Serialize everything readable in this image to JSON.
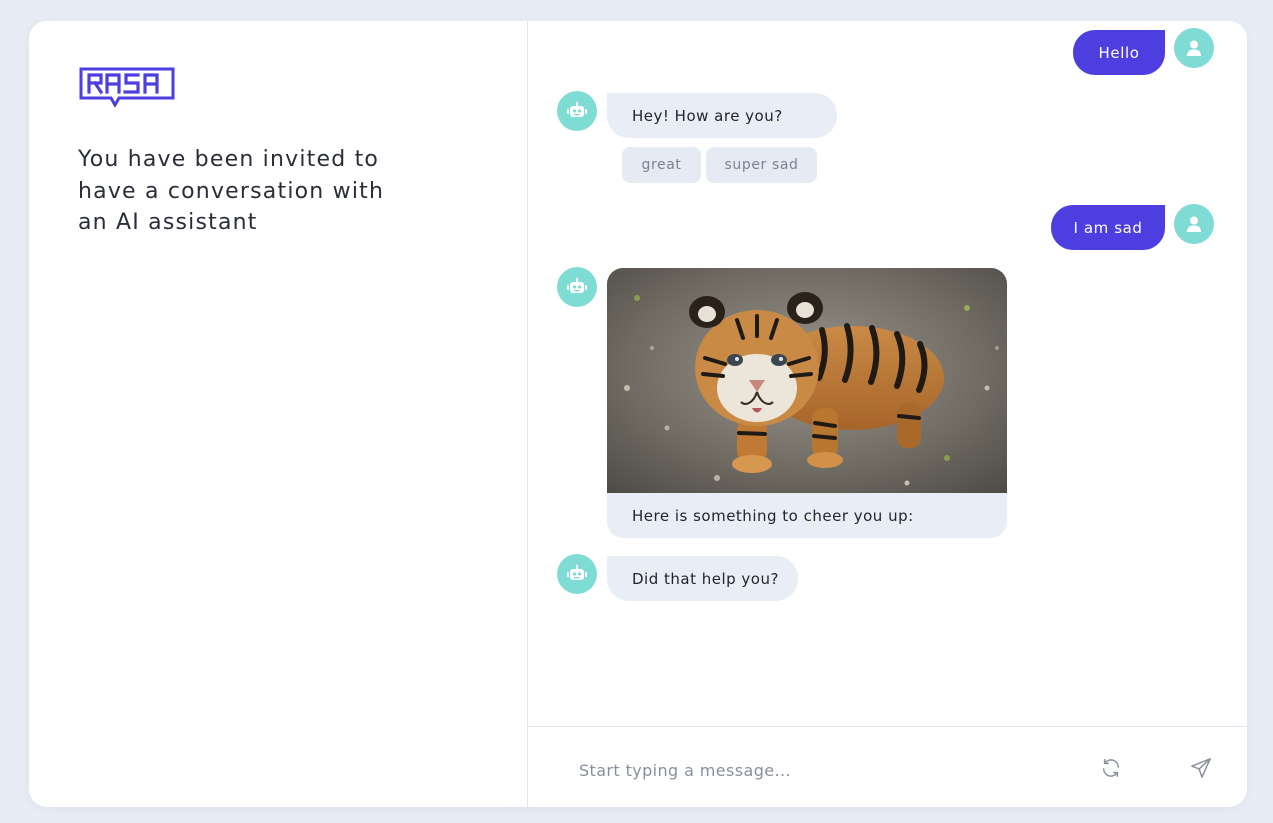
{
  "brand": {
    "logo_text": "RASA",
    "accent": "#4d3ee0",
    "avatar_color": "#7fdcd4"
  },
  "intro": {
    "text": "You have been invited to have a conversation with an AI assistant"
  },
  "chat": {
    "user_messages": [
      "Hello",
      "I am sad"
    ],
    "bot_messages": [
      "Hey! How are you?",
      "Did that help you?"
    ],
    "quick_replies": [
      "great",
      "super sad"
    ],
    "image_caption": "Here is something to cheer you up:"
  },
  "composer": {
    "placeholder": "Start typing a message...",
    "restart_icon": "refresh-icon",
    "send_icon": "send-icon"
  }
}
